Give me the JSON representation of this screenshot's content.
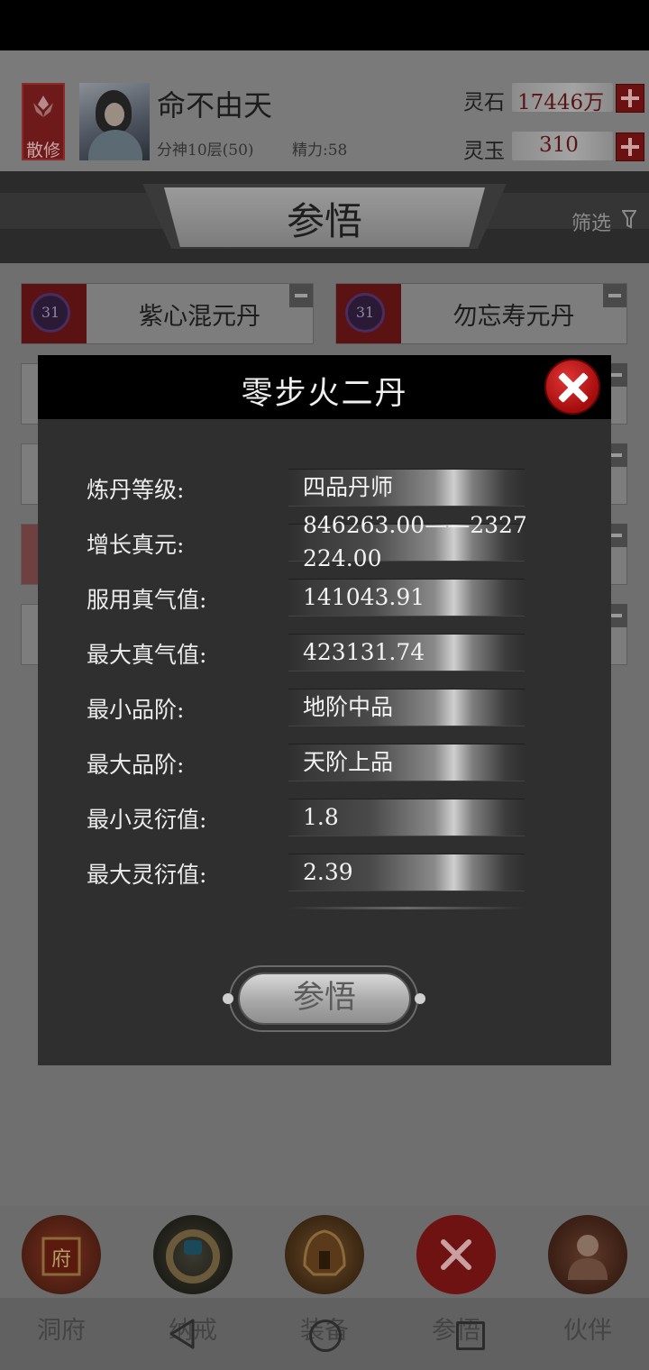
{
  "header": {
    "sect": "散修",
    "player_name": "命不由天",
    "level": "分神10层(50)",
    "energy": "精力:58",
    "currencies": [
      {
        "label": "灵石",
        "value": "17446万"
      },
      {
        "label": "灵玉",
        "value": "310"
      }
    ]
  },
  "tab_title": "参悟",
  "filter_label": "筛选",
  "list": [
    {
      "badge": "31",
      "name": "紫心混元丹"
    },
    {
      "badge": "31",
      "name": "勿忘寿元丹"
    }
  ],
  "modal": {
    "title": "零步火二丹",
    "rows": [
      {
        "label": "炼丹等级:",
        "value": "四品丹师"
      },
      {
        "label": "增长真元:",
        "value": "846263.00——2327224.00"
      },
      {
        "label": "服用真气值:",
        "value": "141043.91"
      },
      {
        "label": "最大真气值:",
        "value": "423131.74"
      },
      {
        "label": "最小品阶:",
        "value": "地阶中品"
      },
      {
        "label": "最大品阶:",
        "value": "天阶上品"
      },
      {
        "label": "最小灵衍值:",
        "value": "1.8"
      },
      {
        "label": "最大灵衍值:",
        "value": "2.39"
      }
    ],
    "action_label": "参悟"
  },
  "bottom_nav": [
    {
      "label": "洞府",
      "icon": "cave-mansion-icon"
    },
    {
      "label": "纳戒",
      "icon": "storage-ring-icon"
    },
    {
      "label": "装备",
      "icon": "helmet-icon"
    },
    {
      "label": "参悟",
      "icon": "close-x-icon"
    },
    {
      "label": "伙伴",
      "icon": "companion-icon"
    }
  ],
  "colors": {
    "accent_red": "#a50c0c",
    "modal_bg": "#2f2f2f",
    "modal_header": "#000000"
  }
}
